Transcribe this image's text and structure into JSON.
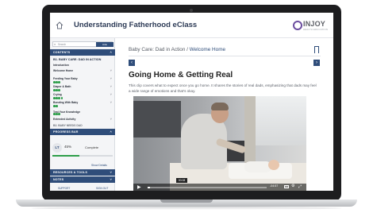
{
  "app": {
    "title": "Understanding Fatherhood eClass",
    "logo_text": "INJOY",
    "logo_sub": "HEALTH EDUCATION"
  },
  "sidebar": {
    "search_label": "Search",
    "hide_label": "Hide",
    "contents_label": "CONTENTS",
    "section_title": "B1. BABY CARE: DAD IN ACTION",
    "items": [
      {
        "label": "Introduction",
        "done": 0
      },
      {
        "label": "Welcome Home",
        "done": 3
      },
      {
        "label": "Feeding Your Baby",
        "done": 3
      },
      {
        "label": "Diaper & Bath",
        "done": 4
      },
      {
        "label": "Crying",
        "done": 2
      },
      {
        "label": "Bonding With Baby",
        "done": 3
      },
      {
        "label": "Test Your Knowledge",
        "done": 0
      },
      {
        "label": "Extended Activity",
        "done": 0
      }
    ],
    "next_section": "B2. BABY NEEDS DAD",
    "progress_label": "PROGRESS BAR",
    "status_code": "LT",
    "percent": "45%",
    "percent_value": 0.45,
    "complete_label": "Complete",
    "show_details": "Show Details",
    "resources_label": "RESOURCES & TOOLS",
    "notes_label": "NOTES",
    "support": "SUPPORT",
    "sign_out": "SIGN OUT"
  },
  "main": {
    "breadcrumb_section": "Baby Care: Dad in Action",
    "breadcrumb_sep": " / ",
    "breadcrumb_current": "Welcome Home",
    "heading": "Going Home & Getting Real",
    "body": "This clip covers what to expect once you go home. It shares the stories of real dads, emphasizing that dads may feel a wide range of emotions and that's okay.",
    "prev_glyph": "‹",
    "next_glyph": "›"
  },
  "video": {
    "time_tooltip": "00:08",
    "duration": "-04:57",
    "cc_label": "CC",
    "played_fraction": 0.02
  },
  "colors": {
    "accent": "#2f4d7a",
    "progress": "#2e9e4a"
  }
}
